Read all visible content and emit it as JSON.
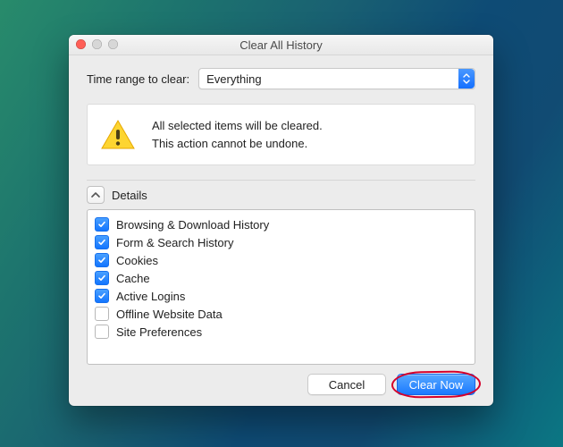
{
  "window": {
    "title": "Clear All History"
  },
  "time_range": {
    "label": "Time range to clear:",
    "value": "Everything"
  },
  "warning": {
    "line1": "All selected items will be cleared.",
    "line2": "This action cannot be undone."
  },
  "details": {
    "label": "Details",
    "expanded": true,
    "items": [
      {
        "label": "Browsing & Download History",
        "checked": true
      },
      {
        "label": "Form & Search History",
        "checked": true
      },
      {
        "label": "Cookies",
        "checked": true
      },
      {
        "label": "Cache",
        "checked": true
      },
      {
        "label": "Active Logins",
        "checked": true
      },
      {
        "label": "Offline Website Data",
        "checked": false
      },
      {
        "label": "Site Preferences",
        "checked": false
      }
    ]
  },
  "buttons": {
    "cancel": "Cancel",
    "clear_now": "Clear Now"
  },
  "annotation": {
    "highlight_target": "clear-now-button",
    "color": "#d4002a"
  }
}
